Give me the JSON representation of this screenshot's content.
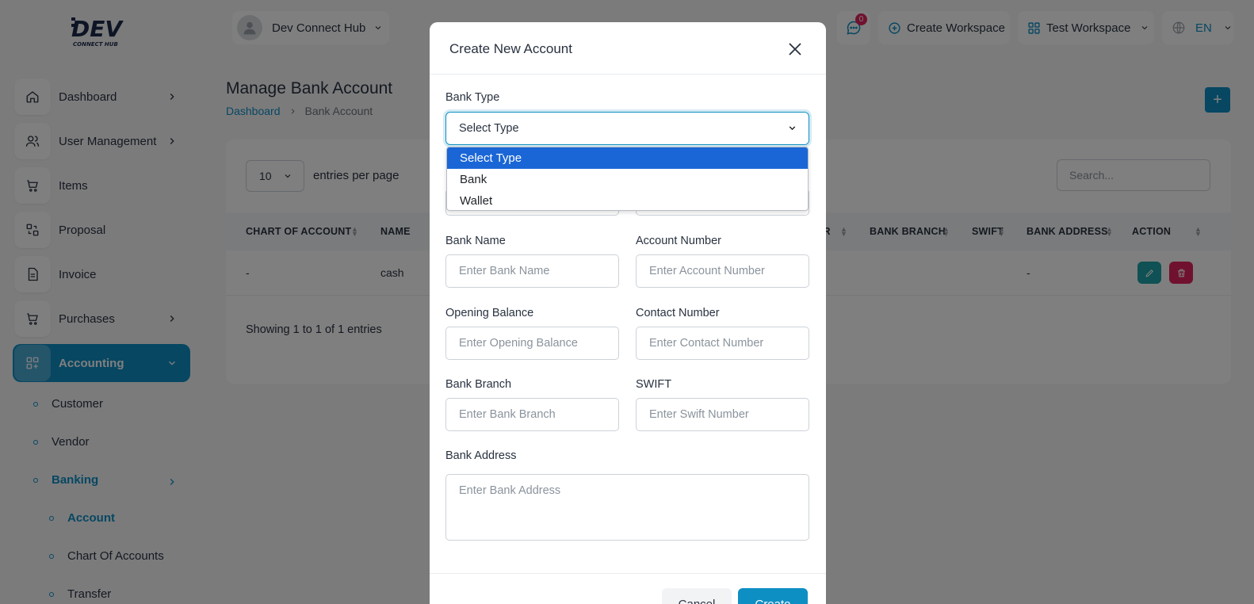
{
  "sidebar": {
    "items": [
      {
        "label": "Dashboard",
        "icon": "home-icon"
      },
      {
        "label": "User Management",
        "icon": "users-icon"
      },
      {
        "label": "Items",
        "icon": "cart-icon"
      },
      {
        "label": "Proposal",
        "icon": "proposal-icon"
      },
      {
        "label": "Invoice",
        "icon": "invoice-icon"
      },
      {
        "label": "Purchases",
        "icon": "cart-icon"
      },
      {
        "label": "Accounting",
        "icon": "grid-plus-icon"
      }
    ],
    "sub_items": [
      "Customer",
      "Vendor",
      "Banking",
      "Account",
      "Chart Of Accounts",
      "Transfer"
    ]
  },
  "header": {
    "workspace_name": "Dev Connect Hub",
    "notification_count": "0",
    "create_workspace": "Create Workspace",
    "current_workspace": "Test Workspace",
    "language": "EN"
  },
  "page": {
    "title": "Manage Bank Account",
    "breadcrumb": [
      "Dashboard",
      "Bank Account"
    ],
    "add_label": "+"
  },
  "table": {
    "entries_value": "10",
    "entries_label": "entries per page",
    "search_placeholder": "Search...",
    "headers": [
      "CHART OF ACCOUNT",
      "NAME",
      "ER",
      "BANK BRANCH",
      "SWIFT",
      "BANK ADDRESS",
      "ACTION"
    ],
    "row": {
      "chart": "-",
      "name": "cash",
      "address": "-"
    },
    "showing": "Showing 1 to 1 of 1 entries"
  },
  "modal": {
    "title": "Create New Account",
    "bank_type_label": "Bank Type",
    "bank_type_value": "Select Type",
    "options": [
      "Select Type",
      "Bank",
      "Wallet"
    ],
    "bank_name_label": "Bank Name",
    "bank_name_placeholder": "Enter Bank Name",
    "account_number_label": "Account Number",
    "account_number_placeholder": "Enter Account Number",
    "opening_balance_label": "Opening Balance",
    "opening_balance_placeholder": "Enter Opening Balance",
    "contact_number_label": "Contact Number",
    "contact_number_placeholder": "Enter Contact Number",
    "bank_branch_label": "Bank Branch",
    "bank_branch_placeholder": "Enter Bank Branch",
    "swift_label": "SWIFT",
    "swift_placeholder": "Enter Swift Number",
    "bank_address_label": "Bank Address",
    "bank_address_placeholder": "Enter Bank Address",
    "cancel_label": "Cancel",
    "create_label": "Create"
  },
  "colors": {
    "accent": "#0e8fc4",
    "danger": "#e0245e",
    "teal": "#1fa2a8"
  }
}
